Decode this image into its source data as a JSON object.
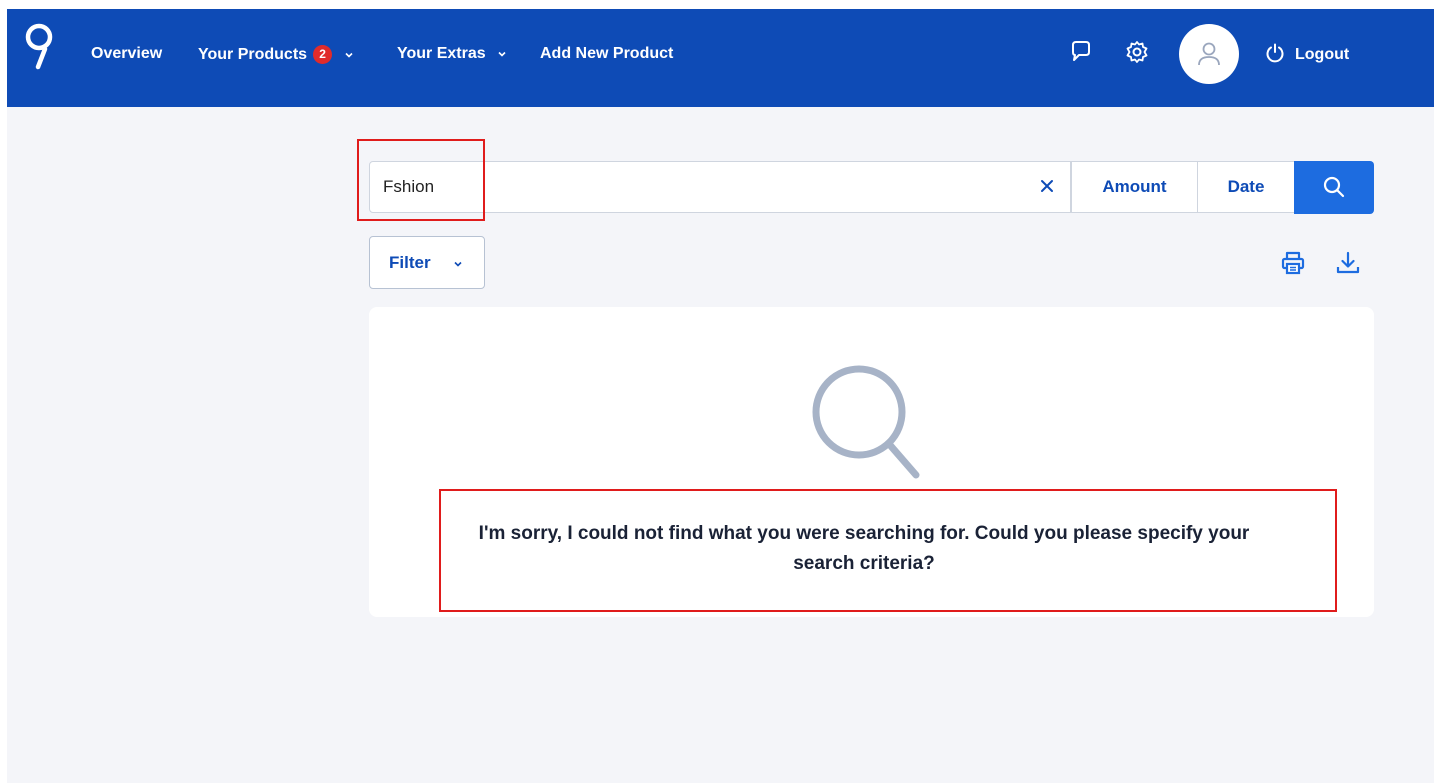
{
  "header": {
    "nav": {
      "overview": "Overview",
      "products": "Your Products",
      "products_badge": "2",
      "extras": "Your Extras",
      "add_product": "Add New Product"
    },
    "logout": "Logout",
    "icons": [
      "logo-icon",
      "chat-icon",
      "gear-icon",
      "user-icon",
      "power-icon"
    ]
  },
  "search": {
    "value": "Fshion",
    "amount_label": "Amount",
    "date_label": "Date",
    "icons": [
      "close-icon",
      "search-icon"
    ]
  },
  "toolbar": {
    "filter_label": "Filter",
    "icons": [
      "chevron-down-icon",
      "print-icon",
      "download-icon"
    ]
  },
  "results": {
    "empty_message": "I'm sorry, I could not find what you were searching for. Could you please specify your search criteria?",
    "icon": "magnifier-icon"
  },
  "colors": {
    "header_bg": "#0e4bb6",
    "accent": "#1d6ce0",
    "badge": "#e02b2b",
    "annotation": "#e01c1c",
    "page_bg": "#f4f5f9"
  }
}
